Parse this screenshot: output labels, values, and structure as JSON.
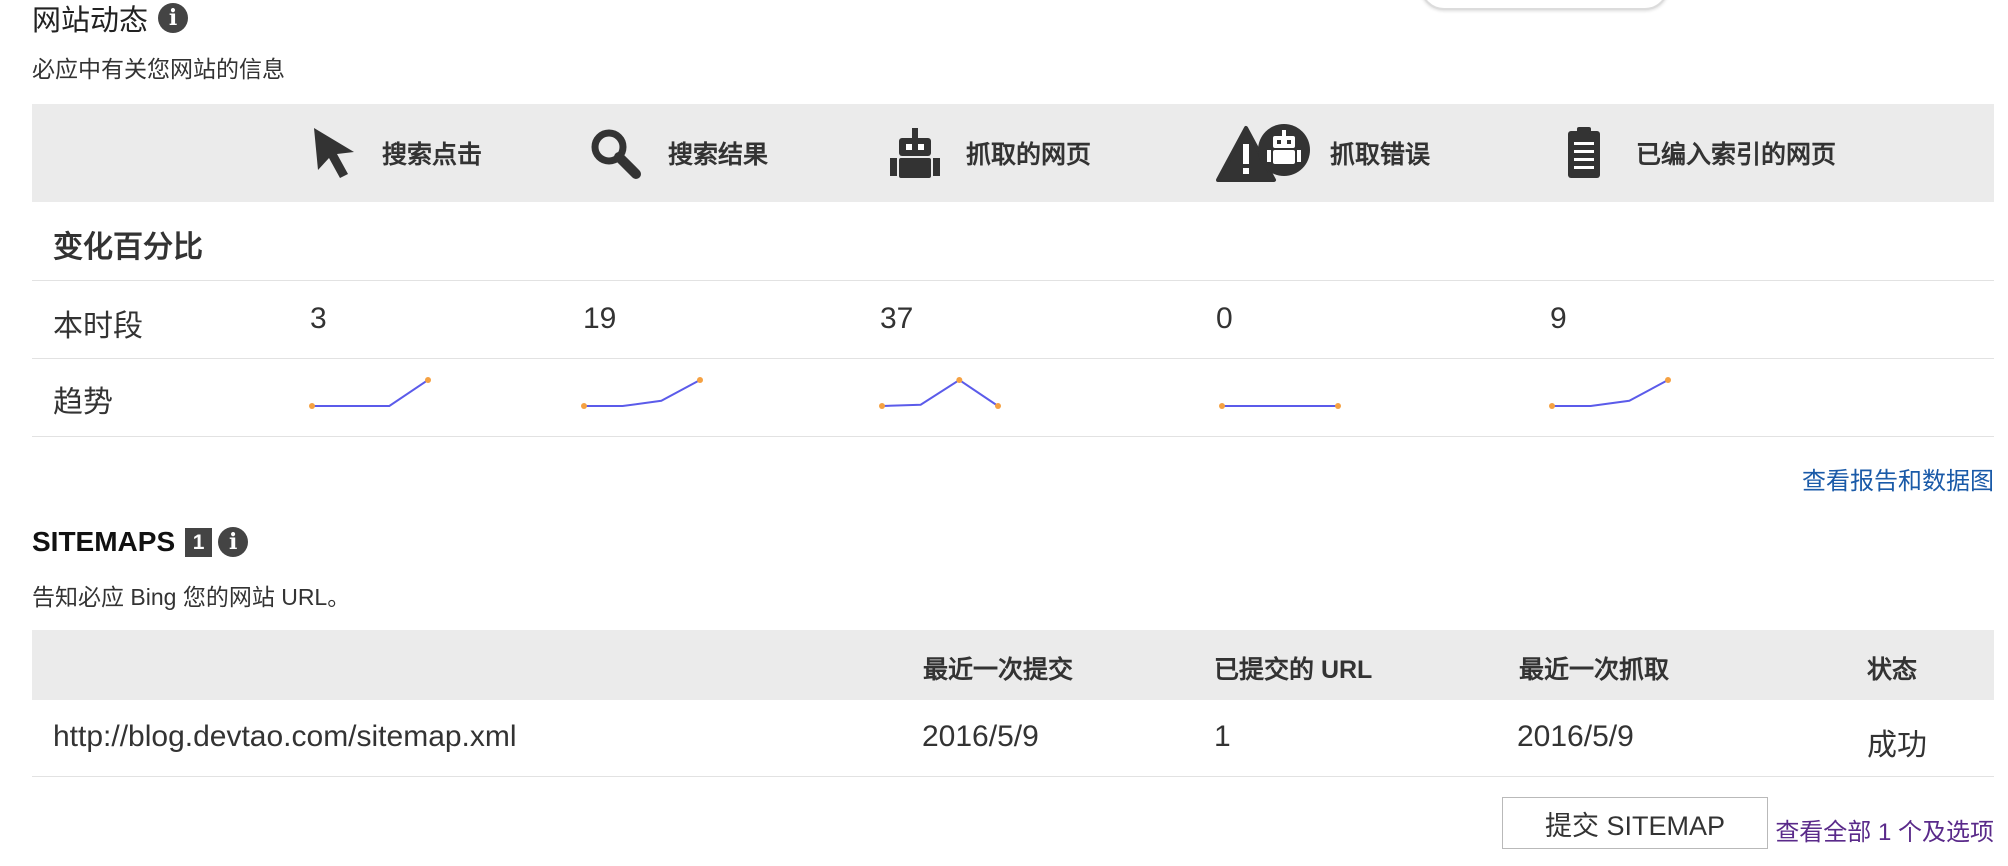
{
  "activity": {
    "title": "网站动态",
    "info_glyph": "i",
    "subtitle": "必应中有关您网站的信息",
    "metrics": [
      {
        "icon": "cursor-icon",
        "label": "搜索点击",
        "value": "3",
        "trend": [
          0,
          0,
          0,
          1
        ]
      },
      {
        "icon": "search-icon",
        "label": "搜索结果",
        "value": "19",
        "trend": [
          0,
          0,
          0.2,
          1
        ]
      },
      {
        "icon": "robot-icon",
        "label": "抓取的网页",
        "value": "37",
        "trend": [
          0,
          0.05,
          1,
          0
        ]
      },
      {
        "icon": "crawl-error-icon",
        "label": "抓取错误",
        "value": "0",
        "trend": [
          0,
          0,
          0,
          0
        ]
      },
      {
        "icon": "document-icon",
        "label": "已编入索引的网页",
        "value": "9",
        "trend": [
          0,
          0,
          0.2,
          1
        ]
      }
    ],
    "rows": {
      "change_label": "变化百分比",
      "period_label": "本时段",
      "trend_label": "趋势"
    },
    "report_link": "查看报告和数据图",
    "colors": {
      "trend_line": "#5b5bea",
      "trend_point": "#f5a142"
    }
  },
  "sitemaps": {
    "title": "SITEMAPS",
    "count_badge": "1",
    "info_glyph": "i",
    "subtitle": "告知必应 Bing 您的网站 URL。",
    "columns": [
      "",
      "最近一次提交",
      "已提交的 URL",
      "最近一次抓取",
      "状态"
    ],
    "rows": [
      {
        "url": "http://blog.devtao.com/sitemap.xml",
        "last_submitted": "2016/5/9",
        "urls_submitted": "1",
        "last_crawled": "2016/5/9",
        "status": "成功"
      }
    ],
    "submit_button": "提交 SITEMAP",
    "view_all_link": "查看全部 1 个及选项"
  }
}
